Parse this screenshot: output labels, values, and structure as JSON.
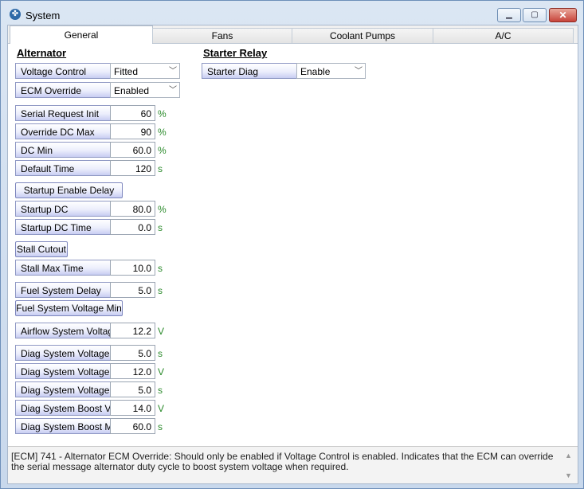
{
  "window": {
    "title": "System",
    "minimize": "▁",
    "maximize": "▢",
    "close": "✕"
  },
  "tabs": [
    "General",
    "Fans",
    "Coolant Pumps",
    "A/C"
  ],
  "alternator": {
    "heading": "Alternator",
    "voltage_control": {
      "label": "Voltage Control",
      "value": "Fitted"
    },
    "ecm_override": {
      "label": "ECM Override",
      "value": "Enabled"
    },
    "serial_request_init": {
      "label": "Serial Request Init",
      "value": "60",
      "unit": "%"
    },
    "override_dc_max": {
      "label": "Override DC Max",
      "value": "90",
      "unit": "%"
    },
    "dc_min": {
      "label": "DC Min",
      "value": "60.0",
      "unit": "%"
    },
    "default_time": {
      "label": "Default Time",
      "value": "120",
      "unit": "s"
    },
    "startup_enable_delay": "Startup Enable Delay",
    "startup_dc": {
      "label": "Startup DC",
      "value": "80.0",
      "unit": "%"
    },
    "startup_dc_time": {
      "label": "Startup DC Time",
      "value": "0.0",
      "unit": "s"
    },
    "stall_cutout": "Stall Cutout",
    "stall_max_time": {
      "label": "Stall Max Time",
      "value": "10.0",
      "unit": "s"
    },
    "fuel_system_delay": {
      "label": "Fuel System Delay",
      "value": "5.0",
      "unit": "s"
    },
    "fuel_system_voltage_min": "Fuel System Voltage Min",
    "airflow_system_voltage": {
      "label": "Airflow System Voltage M",
      "value": "12.2",
      "unit": "V"
    },
    "diag_voltage_delay": {
      "label": "Diag System Voltage De",
      "value": "5.0",
      "unit": "s"
    },
    "diag_voltage_low": {
      "label": "Diag System Voltage Lo",
      "value": "12.0",
      "unit": "V"
    },
    "diag_voltage_low_time": {
      "label": "Diag System Voltage Lo",
      "value": "5.0",
      "unit": "s"
    },
    "diag_boost_voltage": {
      "label": "Diag System Boost Volta",
      "value": "14.0",
      "unit": "V"
    },
    "diag_boost_max": {
      "label": "Diag System Boost Max",
      "value": "60.0",
      "unit": "s"
    }
  },
  "starter_relay": {
    "heading": "Starter Relay",
    "starter_diag": {
      "label": "Starter Diag",
      "value": "Enable"
    }
  },
  "status": {
    "text": "[ECM] 741 - Alternator ECM Override: Should only be enabled if Voltage Control is enabled. Indicates that the ECM can override the serial message alternator duty cycle to boost system voltage when required."
  }
}
